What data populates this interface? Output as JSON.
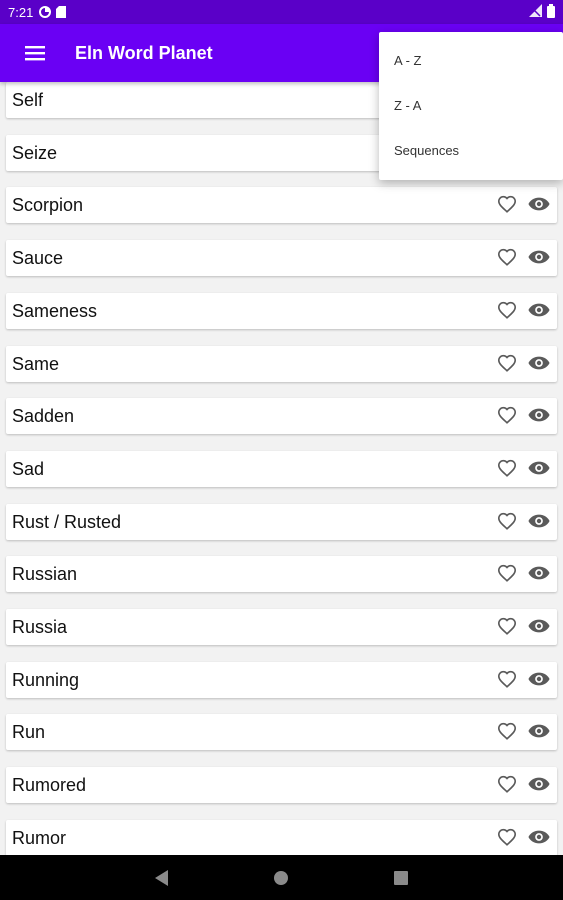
{
  "status_bar": {
    "time": "7:21",
    "icons": [
      "data-saver-icon",
      "sd-card-icon"
    ],
    "right_icons": [
      "signal-icon",
      "battery-icon"
    ]
  },
  "app_bar": {
    "menu_icon": "hamburger-menu-icon",
    "title": "Eln Word Planet",
    "background": "#6a00f4"
  },
  "sort_menu": {
    "items": [
      {
        "label": "A - Z"
      },
      {
        "label": "Z - A"
      },
      {
        "label": "Sequences"
      }
    ]
  },
  "words": [
    {
      "word": "Self"
    },
    {
      "word": "Seize"
    },
    {
      "word": "Scorpion"
    },
    {
      "word": "Sauce"
    },
    {
      "word": "Sameness"
    },
    {
      "word": "Same"
    },
    {
      "word": "Sadden"
    },
    {
      "word": "Sad"
    },
    {
      "word": "Rust / Rusted"
    },
    {
      "word": "Russian"
    },
    {
      "word": "Russia"
    },
    {
      "word": "Running"
    },
    {
      "word": "Run"
    },
    {
      "word": "Rumored"
    },
    {
      "word": "Rumor"
    }
  ],
  "row_icons": [
    "heart-outline-icon",
    "eye-icon"
  ],
  "nav_bar": [
    "back-icon",
    "home-icon",
    "recents-icon"
  ]
}
